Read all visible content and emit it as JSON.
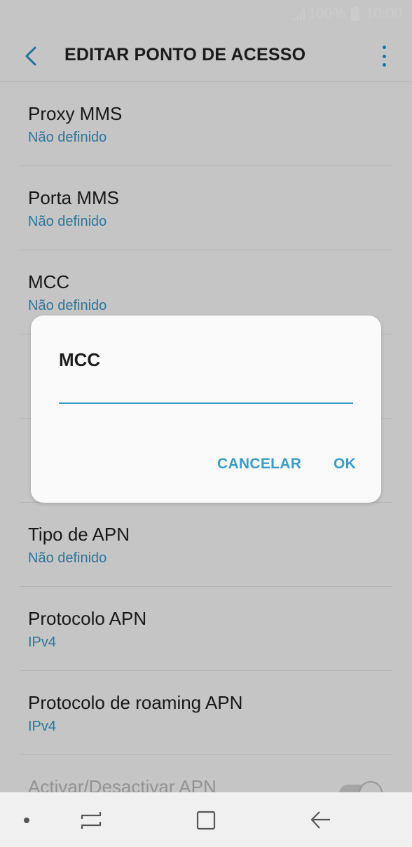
{
  "status_bar": {
    "battery": "100%",
    "time": "10:00"
  },
  "header": {
    "title": "EDITAR PONTO DE ACESSO"
  },
  "list": {
    "items": [
      {
        "title": "Proxy MMS",
        "value": "Não definido"
      },
      {
        "title": "Porta MMS",
        "value": "Não definido"
      },
      {
        "title": "MCC",
        "value": "Não definido"
      },
      {
        "title": "",
        "value": ""
      },
      {
        "title": "",
        "value": ""
      },
      {
        "title": "Tipo de APN",
        "value": "Não definido"
      },
      {
        "title": "Protocolo APN",
        "value": "IPv4"
      },
      {
        "title": "Protocolo de roaming APN",
        "value": "IPv4"
      },
      {
        "title": "Activar/Desactivar APN",
        "value": ""
      }
    ]
  },
  "dialog": {
    "title": "MCC",
    "input_value": "",
    "cancel_label": "CANCELAR",
    "ok_label": "OK"
  },
  "colors": {
    "accent": "#3a9dc5",
    "title_text": "#1d1d1d"
  }
}
